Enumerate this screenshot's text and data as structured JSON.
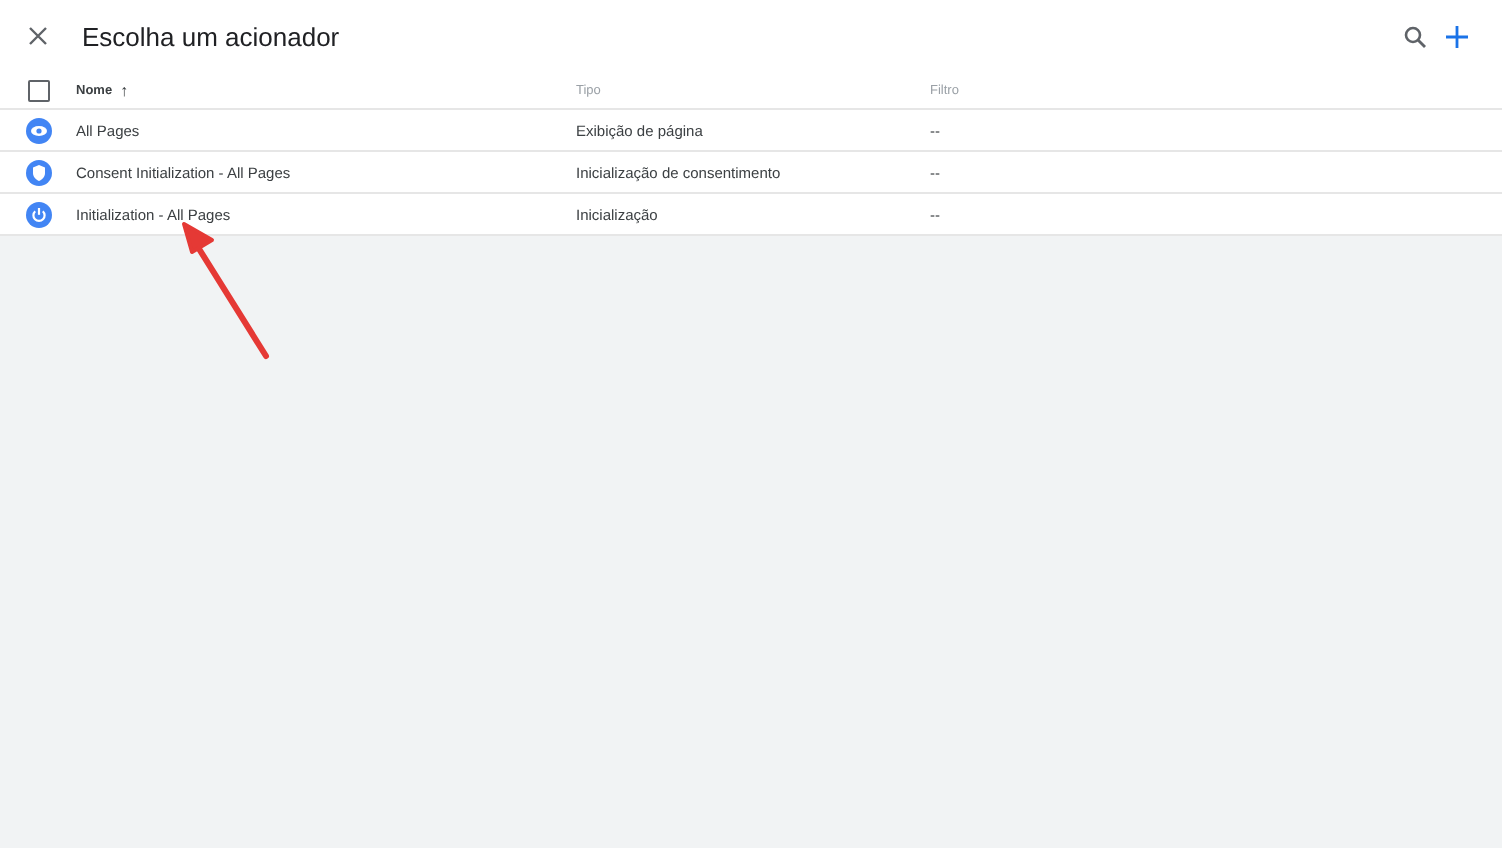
{
  "header": {
    "title": "Escolha um acionador"
  },
  "table": {
    "select_all": {
      "checked": false
    },
    "columns": [
      {
        "label": "Nome",
        "sort_icon": "↑"
      },
      {
        "label": "Tipo"
      },
      {
        "label": "Filtro"
      }
    ],
    "rows": [
      {
        "kind": "pageview",
        "name": "All Pages",
        "type": "Exibição de página",
        "filter": "--"
      },
      {
        "kind": "consent",
        "name": "Consent Initialization - All Pages",
        "type": "Inicialização de consentimento",
        "filter": "--"
      },
      {
        "kind": "init",
        "name": "Initialization - All Pages",
        "type": "Inicialização",
        "filter": "--"
      }
    ]
  },
  "annotation": {
    "kind": "arrow"
  }
}
